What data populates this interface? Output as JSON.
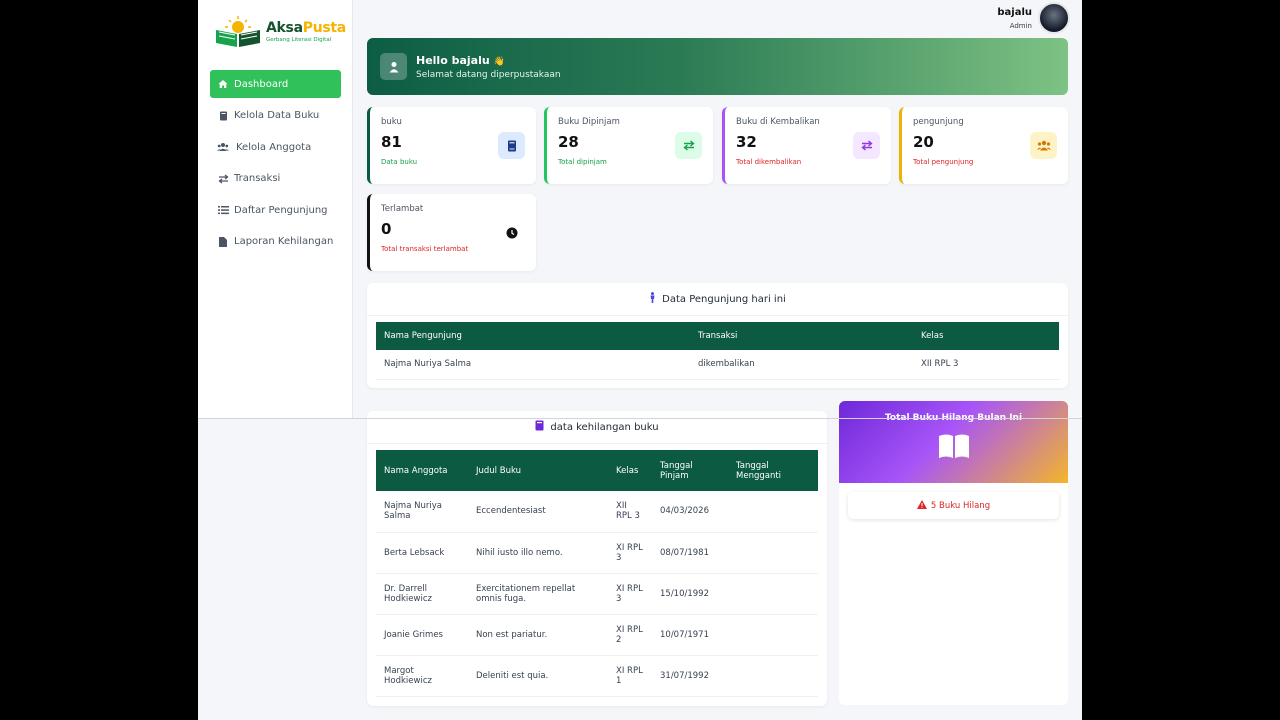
{
  "brand": {
    "title_a": "Aksa",
    "title_b": "Pusta",
    "tagline": "Gerbang Literasi Digital"
  },
  "sidebar": {
    "items": [
      {
        "label": "Dashboard",
        "icon": "home-icon",
        "active": true
      },
      {
        "label": "Kelola Data Buku",
        "icon": "book-icon"
      },
      {
        "label": "Kelola Anggota",
        "icon": "users-icon"
      },
      {
        "label": "Transaksi",
        "icon": "exchange-icon"
      },
      {
        "label": "Daftar Pengunjung",
        "icon": "list-icon"
      },
      {
        "label": "Laporan Kehilangan",
        "icon": "file-icon"
      }
    ]
  },
  "user": {
    "name": "bajalu",
    "role": "Admin"
  },
  "hero": {
    "title": "Hello bajalu",
    "wave": "👋",
    "subtitle": "Selamat datang diperpustakaan"
  },
  "stats": [
    {
      "label": "buku",
      "value": "81",
      "note": "Data buku",
      "color": "#0b5a41",
      "note_color": "#16a34a",
      "icon": "book-icon",
      "icon_bg": "#dbeafe",
      "icon_color": "#1e3a8a"
    },
    {
      "label": "Buku Dipinjam",
      "value": "28",
      "note": "Total dipinjam",
      "color": "#22c55e",
      "note_color": "#16a34a",
      "icon": "exchange-icon",
      "icon_bg": "#dcfce7",
      "icon_color": "#16a34a"
    },
    {
      "label": "Buku di Kembalikan",
      "value": "32",
      "note": "Total dikembalikan",
      "color": "#a855f7",
      "note_color": "#dc2626",
      "icon": "exchange-icon",
      "icon_bg": "#f3e8ff",
      "icon_color": "#9333ea"
    },
    {
      "label": "pengunjung",
      "value": "20",
      "note": "Total pengunjung",
      "color": "#eab308",
      "note_color": "#dc2626",
      "icon": "users-icon",
      "icon_bg": "#fef3c7",
      "icon_color": "#d97706"
    },
    {
      "label": "Terlambat",
      "value": "0",
      "note": "Total transaksi terlambat",
      "color": "#111111",
      "note_color": "#dc2626",
      "icon": "clock-icon",
      "icon_bg": "#ffffff",
      "icon_color": "#111111"
    }
  ],
  "visitors": {
    "title": "Data Pengunjung hari ini",
    "headers": [
      "Nama Pengunjung",
      "Transaksi",
      "Kelas"
    ],
    "rows": [
      [
        "Najma Nuriya Salma",
        "dikembalikan",
        "XII RPL 3"
      ]
    ]
  },
  "lost_table": {
    "title": "data kehilangan buku",
    "headers": [
      "Nama Anggota",
      "Judul Buku",
      "Kelas",
      "Tanggal Pinjam",
      "Tanggal Mengganti"
    ],
    "rows": [
      [
        "Najma Nuriya Salma",
        "Eccendentesiast",
        "XII RPL 3",
        "04/03/2026",
        ""
      ],
      [
        "Berta Lebsack",
        "Nihil iusto illo nemo.",
        "XI RPL 3",
        "08/07/1981",
        ""
      ],
      [
        "Dr. Darrell Hodkiewicz",
        "Exercitationem repellat omnis fuga.",
        "XI RPL 3",
        "15/10/1992",
        ""
      ],
      [
        "Joanie Grimes",
        "Non est pariatur.",
        "XI RPL 2",
        "10/07/1971",
        ""
      ],
      [
        "Margot Hodkiewicz",
        "Deleniti est quia.",
        "XI RPL 1",
        "31/07/1992",
        ""
      ]
    ]
  },
  "lost_summary": {
    "title": "Total Buku Hilang Bulan Ini",
    "badge": "5 Buku Hilang"
  }
}
